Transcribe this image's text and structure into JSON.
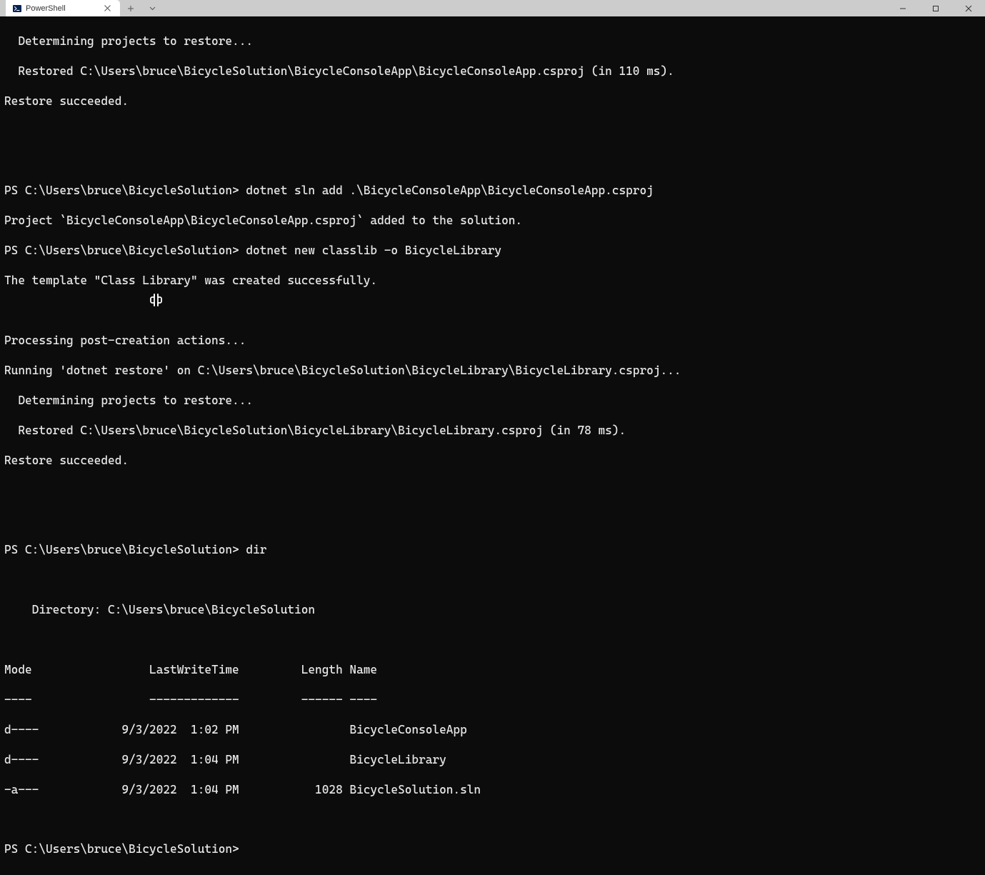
{
  "tab": {
    "title": "PowerShell"
  },
  "terminal": {
    "lines": [
      "  Determining projects to restore...",
      "  Restored C:\\Users\\bruce\\BicycleSolution\\BicycleConsoleApp\\BicycleConsoleApp.csproj (in 110 ms).",
      "Restore succeeded.",
      "",
      "",
      "PS C:\\Users\\bruce\\BicycleSolution> dotnet sln add .\\BicycleConsoleApp\\BicycleConsoleApp.csproj",
      "Project `BicycleConsoleApp\\BicycleConsoleApp.csproj` added to the solution.",
      "PS C:\\Users\\bruce\\BicycleSolution> dotnet new classlib -o BicycleLibrary",
      "The template \"Class Library\" was created successfully.",
      "",
      "Processing post-creation actions...",
      "Running 'dotnet restore' on C:\\Users\\bruce\\BicycleSolution\\BicycleLibrary\\BicycleLibrary.csproj...",
      "  Determining projects to restore...",
      "  Restored C:\\Users\\bruce\\BicycleSolution\\BicycleLibrary\\BicycleLibrary.csproj (in 78 ms).",
      "Restore succeeded.",
      "",
      "",
      "PS C:\\Users\\bruce\\BicycleSolution> dir",
      "",
      "    Directory: C:\\Users\\bruce\\BicycleSolution",
      "",
      "Mode                 LastWriteTime         Length Name",
      "----                 -------------         ------ ----",
      "d----            9/3/2022  1:02 PM                BicycleConsoleApp",
      "d----            9/3/2022  1:04 PM                BicycleLibrary",
      "-a---            9/3/2022  1:04 PM           1028 BicycleSolution.sln",
      "",
      "PS C:\\Users\\bruce\\BicycleSolution> "
    ]
  },
  "dir_listing": {
    "directory": "C:\\Users\\bruce\\BicycleSolution",
    "headers": [
      "Mode",
      "LastWriteTime",
      "Length",
      "Name"
    ],
    "rows": [
      {
        "mode": "d----",
        "date": "9/3/2022",
        "time": "1:02 PM",
        "length": "",
        "name": "BicycleConsoleApp"
      },
      {
        "mode": "d----",
        "date": "9/3/2022",
        "time": "1:04 PM",
        "length": "",
        "name": "BicycleLibrary"
      },
      {
        "mode": "-a---",
        "date": "9/3/2022",
        "time": "1:04 PM",
        "length": "1028",
        "name": "BicycleSolution.sln"
      }
    ]
  },
  "prompt": "PS C:\\Users\\bruce\\BicycleSolution>"
}
